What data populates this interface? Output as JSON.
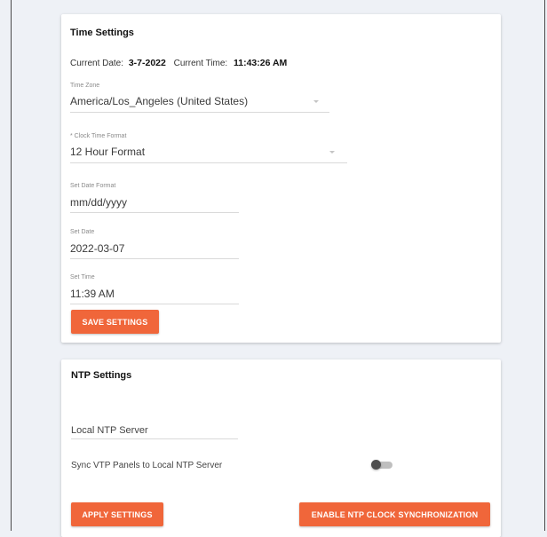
{
  "time_settings": {
    "title": "Time Settings",
    "current_date_label": "Current Date:",
    "current_date_value": "3-7-2022",
    "current_time_label": "Current Time:",
    "current_time_value": "11:43:26 AM",
    "time_zone": {
      "label": "Time Zone",
      "value": "America/Los_Angeles (United States)"
    },
    "clock_format": {
      "label": "* Clock Time Format",
      "value": "12 Hour Format"
    },
    "date_format": {
      "label": "Set Date Format",
      "value": "mm/dd/yyyy"
    },
    "set_date": {
      "label": "Set Date",
      "value": "2022-03-07"
    },
    "set_time": {
      "label": "Set Time",
      "value": "11:39 AM"
    },
    "save_button": "SAVE SETTINGS"
  },
  "ntp_settings": {
    "title": "NTP Settings",
    "local_server_placeholder": "Local NTP Server",
    "sync_label": "Sync VTP Panels to Local NTP Server",
    "sync_enabled": false,
    "apply_button": "APPLY SETTINGS",
    "enable_button": "ENABLE NTP CLOCK SYNCHRONIZATION"
  },
  "colors": {
    "accent": "#f0663a",
    "background": "#eef1f6",
    "card": "#ffffff"
  }
}
